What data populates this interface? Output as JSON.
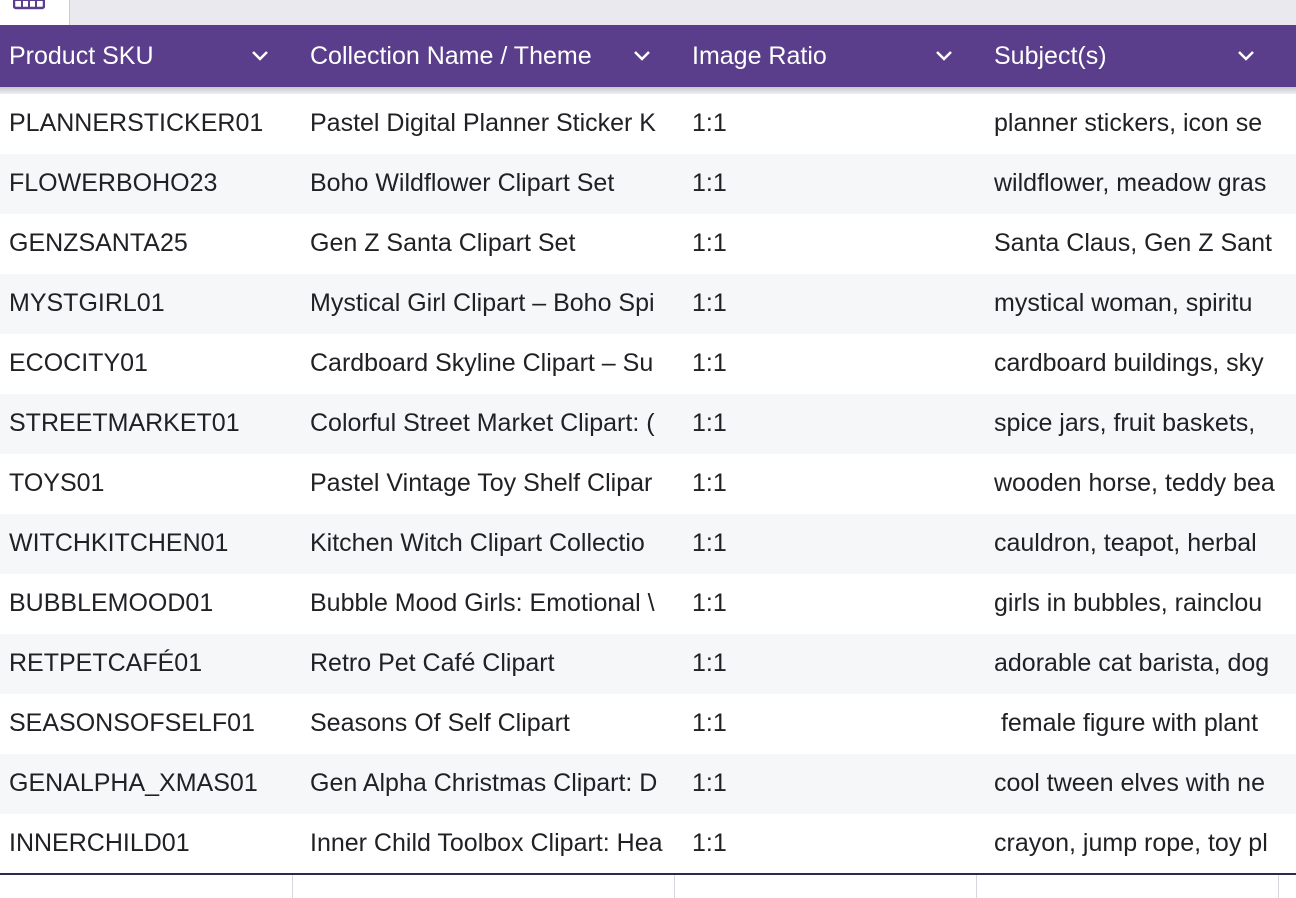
{
  "toolbar": {
    "view_icon": "grid-view-icon"
  },
  "colors": {
    "header_bg": "#5a3e8c",
    "header_text": "#ffffff",
    "row_alt_bg": "#f6f7f9",
    "text": "#202124"
  },
  "columns": [
    {
      "label": "Product SKU",
      "icon": "chevron-down-icon"
    },
    {
      "label": "Collection Name / Theme",
      "icon": "chevron-down-icon"
    },
    {
      "label": "Image Ratio",
      "icon": "chevron-down-icon"
    },
    {
      "label": "Subject(s)",
      "icon": "chevron-down-icon"
    }
  ],
  "rows": [
    {
      "sku": "PLANNERSTICKER01",
      "collection": "Pastel Digital Planner Sticker K",
      "ratio": "1:1",
      "subjects": "planner stickers, icon se"
    },
    {
      "sku": "FLOWERBOHO23",
      "collection": "Boho Wildflower Clipart Set",
      "ratio": "1:1",
      "subjects": "wildflower, meadow gras"
    },
    {
      "sku": "GENZSANTA25",
      "collection": "Gen Z Santa Clipart Set",
      "ratio": "1:1",
      "subjects": "Santa Claus, Gen Z Sant"
    },
    {
      "sku": "MYSTGIRL01",
      "collection": "Mystical Girl Clipart – Boho Spi",
      "ratio": "1:1",
      "subjects": "mystical woman, spiritu"
    },
    {
      "sku": "ECOCITY01",
      "collection": "Cardboard Skyline Clipart – Su",
      "ratio": "1:1",
      "subjects": "cardboard buildings, sky"
    },
    {
      "sku": "STREETMARKET01",
      "collection": "Colorful Street Market Clipart: (",
      "ratio": "1:1",
      "subjects": "spice jars, fruit baskets,"
    },
    {
      "sku": "TOYS01",
      "collection": "Pastel Vintage Toy Shelf Clipar",
      "ratio": "1:1",
      "subjects": "wooden horse, teddy bea"
    },
    {
      "sku": "WITCHKITCHEN01",
      "collection": "Kitchen Witch Clipart Collectio",
      "ratio": "1:1",
      "subjects": "cauldron, teapot, herbal"
    },
    {
      "sku": "BUBBLEMOOD01",
      "collection": "Bubble Mood Girls: Emotional \\",
      "ratio": "1:1",
      "subjects": "girls in bubbles, rainclou"
    },
    {
      "sku": "RETPETCAFÉ01",
      "collection": "Retro Pet Café Clipart",
      "ratio": "1:1",
      "subjects": "adorable cat barista, dog"
    },
    {
      "sku": "SEASONSOFSELF01",
      "collection": "Seasons Of Self Clipart",
      "ratio": "1:1",
      "subjects": " female figure with plant"
    },
    {
      "sku": "GENALPHA_XMAS01",
      "collection": "Gen Alpha Christmas Clipart: D",
      "ratio": "1:1",
      "subjects": "cool tween elves with ne"
    },
    {
      "sku": "INNERCHILD01",
      "collection": "Inner Child Toolbox Clipart: Hea",
      "ratio": "1:1",
      "subjects": "crayon, jump rope, toy pl"
    }
  ]
}
